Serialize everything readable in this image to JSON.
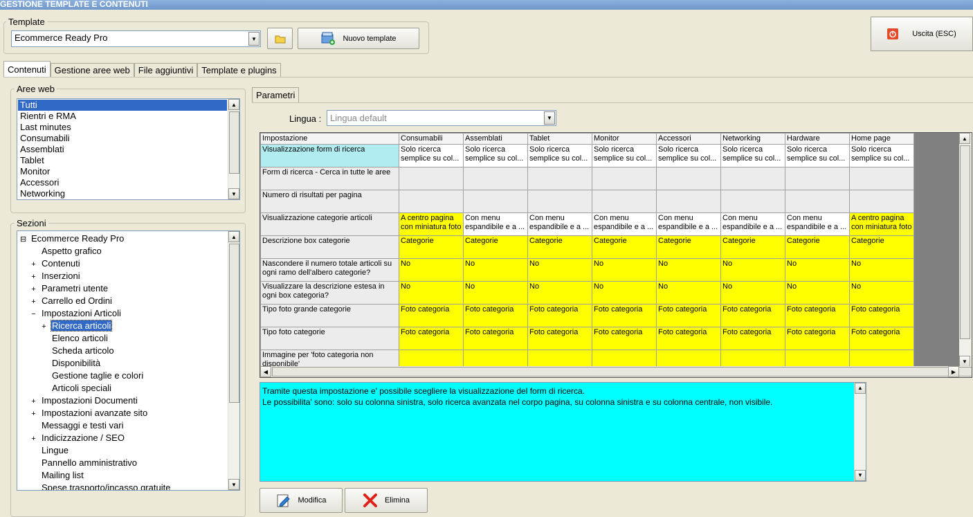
{
  "title": "GESTIONE TEMPLATE E CONTENUTI",
  "template": {
    "group_label": "Template",
    "selected": "Ecommerce Ready Pro",
    "new_template_label": "Nuovo template"
  },
  "exit_label": "Uscita (ESC)",
  "tabs": [
    "Contenuti",
    "Gestione aree web",
    "File aggiuntivi",
    "Template e plugins"
  ],
  "aree_web": {
    "label": "Aree web",
    "items": [
      "Tutti",
      "Rientri e RMA",
      "Last minutes",
      "Consumabili",
      "Assemblati",
      "Tablet",
      "Monitor",
      "Accessori",
      "Networking"
    ]
  },
  "sezioni": {
    "label": "Sezioni",
    "items": [
      {
        "label": "Ecommerce Ready Pro",
        "exp": "⊟"
      },
      {
        "label": "Aspetto grafico",
        "exp": ""
      },
      {
        "label": "Contenuti",
        "exp": "+"
      },
      {
        "label": "Inserzioni",
        "exp": "+"
      },
      {
        "label": "Parametri utente",
        "exp": "+"
      },
      {
        "label": "Carrello ed Ordini",
        "exp": "+"
      },
      {
        "label": "Impostazioni Articoli",
        "exp": "−"
      },
      {
        "label": "Ricerca articoli",
        "exp": "+"
      },
      {
        "label": "Elenco articoli",
        "exp": ""
      },
      {
        "label": "Scheda articolo",
        "exp": ""
      },
      {
        "label": "Disponibilità",
        "exp": ""
      },
      {
        "label": "Gestione taglie e colori",
        "exp": ""
      },
      {
        "label": "Articoli speciali",
        "exp": ""
      },
      {
        "label": "Impostazioni Documenti",
        "exp": "+"
      },
      {
        "label": "Impostazioni avanzate sito",
        "exp": "+"
      },
      {
        "label": "Messaggi e testi vari",
        "exp": ""
      },
      {
        "label": "Indicizzazione / SEO",
        "exp": "+"
      },
      {
        "label": "Lingue",
        "exp": ""
      },
      {
        "label": "Pannello amministrativo",
        "exp": ""
      },
      {
        "label": "Mailing list",
        "exp": ""
      },
      {
        "label": "Spese trasporto/incasso gratuite",
        "exp": ""
      }
    ]
  },
  "parametri": {
    "tab_label": "Parametri",
    "lingua_label": "Lingua :",
    "lingua_value": "Lingua default"
  },
  "grid": {
    "columns": [
      "Impostazione",
      "Consumabili",
      "Assemblati",
      "Tablet",
      "Monitor",
      "Accessori",
      "Networking",
      "Hardware",
      "Home page"
    ],
    "rows": [
      {
        "label": "Visualizzazione form di ricerca",
        "values": [
          "Solo ricerca semplice su col...",
          "Solo ricerca semplice su col...",
          "Solo ricerca semplice su col...",
          "Solo ricerca semplice su col...",
          "Solo ricerca semplice su col...",
          "Solo ricerca semplice su col...",
          "Solo ricerca semplice su col...",
          "Solo ricerca semplice su col..."
        ],
        "style": [
          "w",
          "w",
          "w",
          "w",
          "w",
          "w",
          "w",
          "w"
        ]
      },
      {
        "label": "Form di ricerca - Cerca in tutte le aree",
        "values": [
          "",
          "",
          "",
          "",
          "",
          "",
          "",
          ""
        ],
        "style": [
          "g",
          "g",
          "g",
          "g",
          "g",
          "g",
          "g",
          "g"
        ]
      },
      {
        "label": "Numero di risultati per pagina",
        "values": [
          "",
          "",
          "",
          "",
          "",
          "",
          "",
          ""
        ],
        "style": [
          "g",
          "g",
          "g",
          "g",
          "g",
          "g",
          "g",
          "g"
        ]
      },
      {
        "label": "Visualizzazione categorie articoli",
        "values": [
          "A centro pagina con miniatura foto",
          "Con menu espandibile e a ...",
          "Con menu espandibile e a ...",
          "Con menu espandibile e a ...",
          "Con menu espandibile e a ...",
          "Con menu espandibile e a ...",
          "Con menu espandibile e a ...",
          "A centro pagina con miniatura foto"
        ],
        "style": [
          "y",
          "w",
          "w",
          "w",
          "w",
          "w",
          "w",
          "y"
        ]
      },
      {
        "label": "Descrizione box categorie",
        "values": [
          "Categorie",
          "Categorie",
          "Categorie",
          "Categorie",
          "Categorie",
          "Categorie",
          "Categorie",
          "Categorie"
        ],
        "style": [
          "y",
          "y",
          "y",
          "y",
          "y",
          "y",
          "y",
          "y"
        ]
      },
      {
        "label": "Nascondere il numero totale articoli su ogni ramo dell'albero categorie?",
        "values": [
          "No",
          "No",
          "No",
          "No",
          "No",
          "No",
          "No",
          "No"
        ],
        "style": [
          "y",
          "y",
          "y",
          "y",
          "y",
          "y",
          "y",
          "y"
        ]
      },
      {
        "label": "Visualizzare la descrizione estesa in ogni box categoria?",
        "values": [
          "No",
          "No",
          "No",
          "No",
          "No",
          "No",
          "No",
          "No"
        ],
        "style": [
          "y",
          "y",
          "y",
          "y",
          "y",
          "y",
          "y",
          "y"
        ]
      },
      {
        "label": "Tipo foto grande categorie",
        "values": [
          "Foto categoria",
          "Foto categoria",
          "Foto categoria",
          "Foto categoria",
          "Foto categoria",
          "Foto categoria",
          "Foto categoria",
          "Foto categoria"
        ],
        "style": [
          "y",
          "y",
          "y",
          "y",
          "y",
          "y",
          "y",
          "y"
        ]
      },
      {
        "label": "Tipo foto categorie",
        "values": [
          "Foto categoria",
          "Foto categoria",
          "Foto categoria",
          "Foto categoria",
          "Foto categoria",
          "Foto categoria",
          "Foto categoria",
          "Foto categoria"
        ],
        "style": [
          "y",
          "y",
          "y",
          "y",
          "y",
          "y",
          "y",
          "y"
        ]
      },
      {
        "label": "Immagine per 'foto categoria non disponibile'",
        "values": [
          "",
          "",
          "",
          "",
          "",
          "",
          "",
          ""
        ],
        "style": [
          "y",
          "y",
          "y",
          "y",
          "y",
          "y",
          "y",
          "y"
        ]
      }
    ]
  },
  "description": {
    "line1": "Tramite questa impostazione e' possibile scegliere la visualizzazione del form di ricerca.",
    "line2": "Le possibilita' sono: solo su colonna sinistra, solo ricerca avanzata nel corpo pagina, su colonna sinistra e su colonna centrale, non visibile."
  },
  "buttons": {
    "modifica": "Modifica",
    "elimina": "Elimina"
  },
  "colors": {
    "highlight": "#ffff00",
    "selected_cell": "#b0ecf0",
    "description_bg": "#00ffff",
    "selection": "#3169c6"
  }
}
